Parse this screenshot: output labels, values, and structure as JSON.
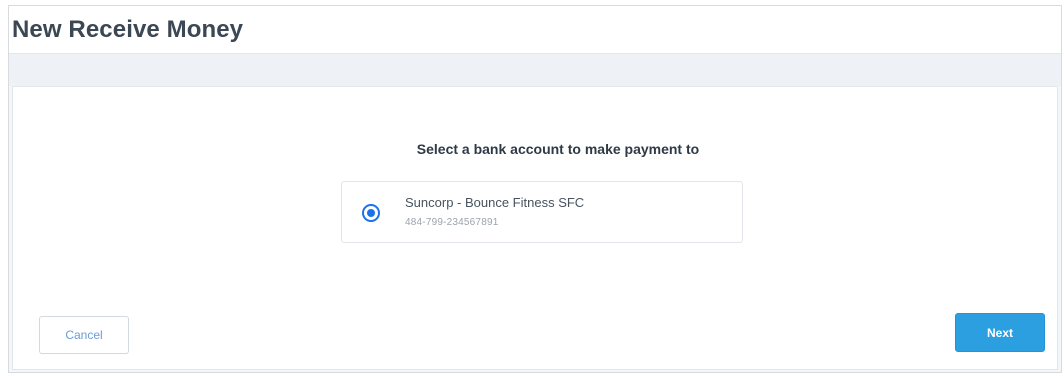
{
  "header": {
    "title": "New Receive Money"
  },
  "main": {
    "prompt": "Select a bank account to make payment to",
    "accounts": [
      {
        "name": "Suncorp - Bounce Fitness SFC",
        "number": "484-799-234567891",
        "selected": true
      }
    ]
  },
  "footer": {
    "cancel_label": "Cancel",
    "next_label": "Next"
  },
  "colors": {
    "accent": "#1a73e8",
    "primary_button": "#2b9fe0",
    "title_text": "#3b4753"
  }
}
